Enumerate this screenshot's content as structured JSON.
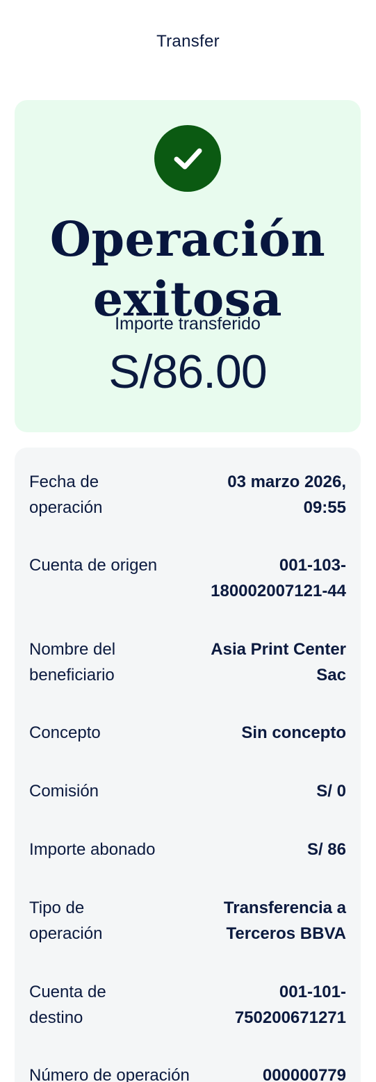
{
  "header": {
    "title": "Transfer"
  },
  "success": {
    "icon": "check-icon",
    "icon_color": "#0b5a12",
    "background": "#e8fbee",
    "title_line1": "Operación",
    "title_line2": "exitosa",
    "amount_label": "Importe transferido",
    "amount_value": "S/86.00"
  },
  "details": {
    "rows": [
      {
        "label_line1": "Fecha de",
        "label_line2": "operación",
        "value_line1": "03 marzo 2026,",
        "value_line2": "09:55"
      },
      {
        "label_line1": "Cuenta de origen",
        "label_line2": "",
        "value_line1": "001-103-",
        "value_line2": "180002007121-44"
      },
      {
        "label_line1": "Nombre del",
        "label_line2": "beneficiario",
        "value_line1": "Asia Print Center",
        "value_line2": "Sac"
      },
      {
        "label_line1": "Concepto",
        "label_line2": "",
        "value_line1": "Sin concepto",
        "value_line2": ""
      },
      {
        "label_line1": "Comisión",
        "label_line2": "",
        "value_line1": "S/ 0",
        "value_line2": ""
      },
      {
        "label_line1": "Importe abonado",
        "label_line2": "",
        "value_line1": "S/ 86",
        "value_line2": ""
      },
      {
        "label_line1": "Tipo de",
        "label_line2": "operación",
        "value_line1": "Transferencia a",
        "value_line2": "Terceros BBVA"
      },
      {
        "label_line1": "Cuenta de",
        "label_line2": "destino",
        "value_line1": "001-101-",
        "value_line2": "750200671271"
      },
      {
        "label_line1": "Número de operación",
        "label_line2": "",
        "value_line1": "000000779",
        "value_line2": ""
      }
    ]
  }
}
